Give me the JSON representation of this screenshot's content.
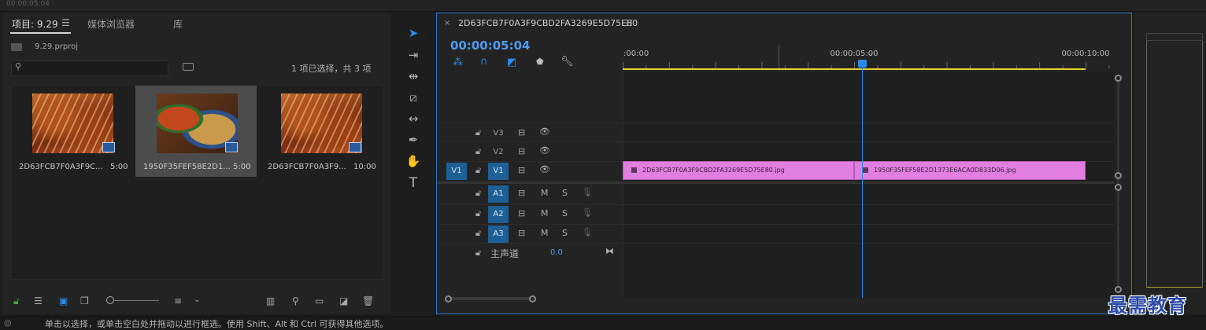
{
  "top": {
    "timecode": "00:00:05:04"
  },
  "project": {
    "tabs": [
      {
        "label": "项目: 9.29",
        "active": true
      },
      {
        "label": "媒体浏览器",
        "active": false
      },
      {
        "label": "库",
        "active": false
      }
    ],
    "file": "9.29.prproj",
    "search_placeholder": "",
    "selection_status": "1 项已选择，共 3 项",
    "items": [
      {
        "name": "2D63FCB7F0A3F9C...",
        "duration": "5:00",
        "selected": false,
        "image": "food-skewers"
      },
      {
        "name": "1950F35FEF58E2D1...",
        "duration": "5:00",
        "selected": true,
        "image": "food-plates"
      },
      {
        "name": "2D63FCB7F0A3F9...",
        "duration": "10:00",
        "selected": false,
        "image": "food-skewers",
        "sequence": true
      }
    ]
  },
  "timeline": {
    "sequence_name": "2D63FCB7F0A3F9CBD2FA3269E5D75E80",
    "timecode": "00:00:05:04",
    "ruler_labels": [
      ":00:00",
      "00:00:05:00",
      "00:00:10:00"
    ],
    "video_tracks": [
      "V3",
      "V2",
      "V1"
    ],
    "source_patch": "V1",
    "audio_tracks": [
      "A1",
      "A2",
      "A3"
    ],
    "audio_buttons": {
      "mute": "M",
      "solo": "S"
    },
    "master": {
      "label": "主声道",
      "value": "0.0"
    },
    "clips": [
      {
        "name": "2D63FCB7F0A3F9CBD2FA3269E5D75E80.jpg",
        "start": 0,
        "end": 5
      },
      {
        "name": "1950F35FEF58E2D1373E6ACA0D833D06.jpg",
        "start": 5,
        "end": 10
      }
    ],
    "playhead_time": "00:00:05:04",
    "ruler_range_seconds": [
      0,
      10.5
    ]
  },
  "status_bar": {
    "text": "单击以选择，或单击空白处并拖动以进行框选。使用 Shift、Alt 和 Ctrl 可获得其他选项。"
  },
  "watermark": "最需教育",
  "colors": {
    "accent": "#2d8ceb",
    "clip": "#e17fe0",
    "track_target": "#1e5f95",
    "work_area": "#e6d52b"
  }
}
